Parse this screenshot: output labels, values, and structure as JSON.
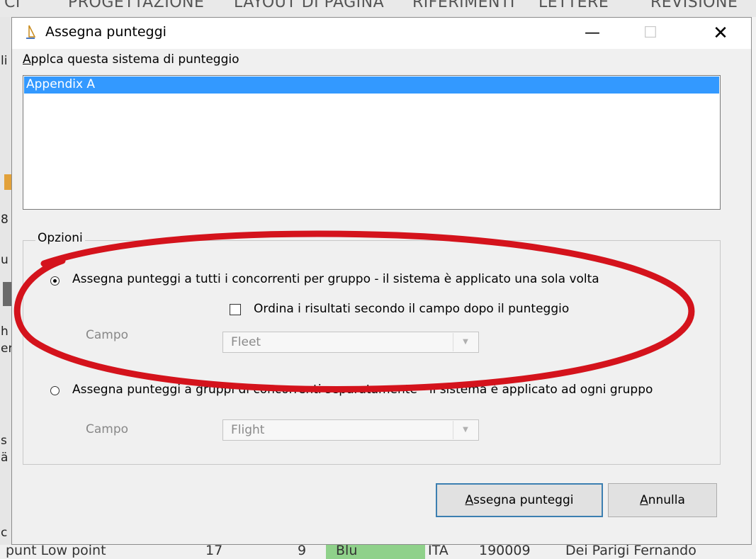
{
  "background": {
    "ribbon_tabs": [
      "CI",
      "PROGETTAZIONE",
      "LAYOUT DI PAGINA",
      "RIFERIMENTI",
      "LETTERE",
      "REVISIONE"
    ],
    "left_fragments": [
      "li",
      "8",
      "u",
      "h",
      "er",
      "s",
      "ä",
      "c"
    ],
    "bottom_row": [
      "punt Low point",
      "17",
      "9",
      "Blu",
      "ITA",
      "190009",
      "Dei Parigi Fernando"
    ]
  },
  "dialog": {
    "title": "Assegna punteggi",
    "icon": "sailboat-icon",
    "window_controls": {
      "minimize": "—",
      "maximize": "☐",
      "close": "✕"
    },
    "scoring_label_accel": "A",
    "scoring_label_rest": "pplca questa sistema di punteggio",
    "scoring_systems": [
      "Appendix A"
    ],
    "selected_system": "Appendix A",
    "options": {
      "legend": "Opzioni",
      "option1": {
        "label": "Assegna punteggi a tutti i concorrenti per gruppo  -  il sistema è applicato una sola volta",
        "selected": true,
        "sort_checkbox": {
          "label": "Ordina i risultati secondo il campo dopo il punteggio",
          "checked": false
        },
        "field_label": "Campo",
        "field_value": "Fleet"
      },
      "option2": {
        "label": "Assegna punteggi a gruppi di concorrenti separatamente  -  il sistema è applicato ad ogni gruppo",
        "selected": false,
        "field_label": "Campo",
        "field_value": "Flight"
      }
    },
    "buttons": {
      "assign_accel": "A",
      "assign_rest": "ssegna punteggi",
      "cancel_accel": "A",
      "cancel_rest": "nnulla"
    }
  },
  "colors": {
    "selection": "#3399ff",
    "annotation": "#d4131c",
    "default_button_border": "#3c7fb1"
  }
}
